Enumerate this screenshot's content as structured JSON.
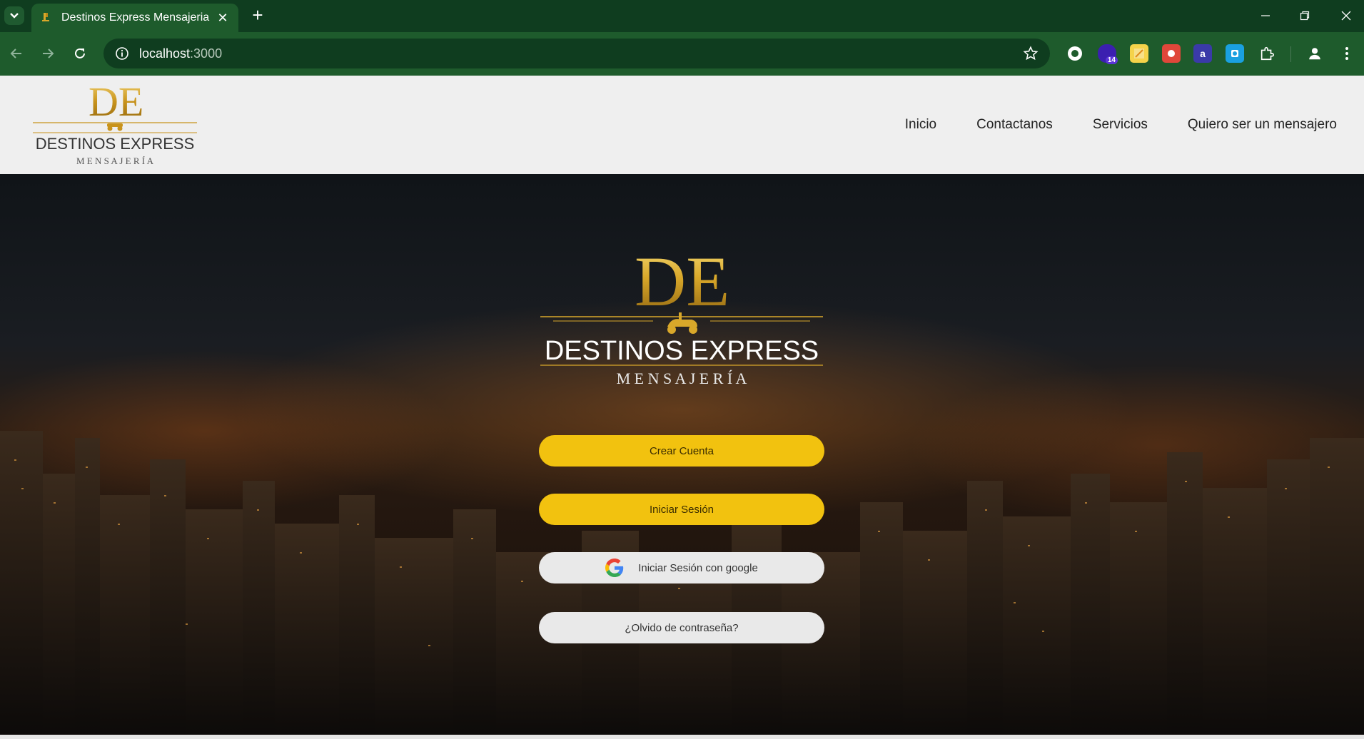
{
  "browser": {
    "tab_title": "Destinos Express Mensajeria",
    "url_host": "localhost",
    "url_port": ":3000",
    "extension_badge": "14",
    "ext_letter": "a"
  },
  "header": {
    "logo_alt": "Destinos Express Mensajería",
    "nav": [
      {
        "label": "Inicio"
      },
      {
        "label": "Contactanos"
      },
      {
        "label": "Servicios"
      },
      {
        "label": "Quiero ser un mensajero"
      }
    ]
  },
  "logo": {
    "monogram": "DE",
    "wordmark": "DESTINOS EXPRESS",
    "tagline": "M E N S A J E R Í A"
  },
  "actions": {
    "create_account": "Crear Cuenta",
    "sign_in": "Iniciar Sesión",
    "google_sign_in": "Iniciar Sesión con google",
    "forgot_password": "¿Olvido de contraseña?"
  },
  "colors": {
    "chrome_dark": "#0f3d1f",
    "chrome": "#1e5b2c",
    "gold": "#d9a82a",
    "button_yellow": "#f2c20f",
    "button_light": "#e9e9e9"
  }
}
